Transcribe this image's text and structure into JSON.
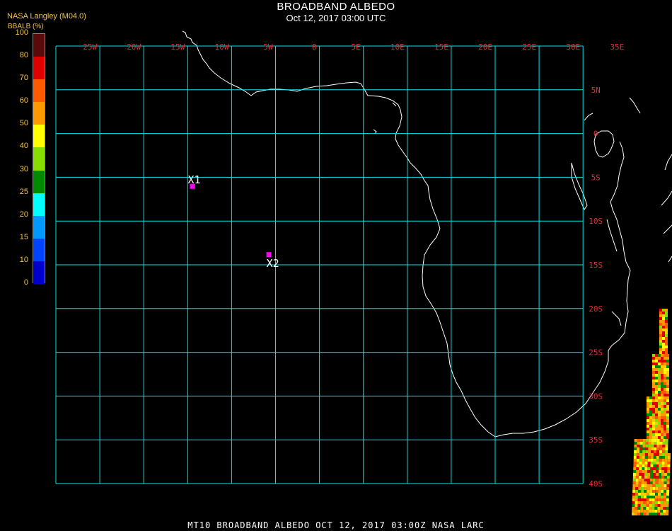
{
  "header": {
    "title": "BROADBAND ALBEDO",
    "subtitle": "Oct 12, 2017 03:00 UTC",
    "source": "NASA Langley (M04.0)"
  },
  "legend": {
    "title": "BBALB (%)",
    "bins": [
      {
        "label": "100",
        "color": "#5a0a0a"
      },
      {
        "label": "80",
        "color": "#e00000"
      },
      {
        "label": "70",
        "color": "#ff5a00"
      },
      {
        "label": "60",
        "color": "#ff9900"
      },
      {
        "label": "50",
        "color": "#ffff00"
      },
      {
        "label": "40",
        "color": "#88dd00"
      },
      {
        "label": "30",
        "color": "#008a00"
      },
      {
        "label": "25",
        "color": "#00ffff"
      },
      {
        "label": "20",
        "color": "#0099ff"
      },
      {
        "label": "15",
        "color": "#0044ff"
      },
      {
        "label": "10",
        "color": "#0000cc"
      },
      {
        "label": "0",
        "color": "#9933cc"
      }
    ]
  },
  "map": {
    "lon_labels": [
      "25W",
      "20W",
      "15W",
      "10W",
      "5W",
      "0",
      "5E",
      "10E",
      "15E",
      "20E",
      "25E",
      "30E",
      "35E"
    ],
    "lat_labels": [
      "5N",
      "0",
      "5S",
      "10S",
      "15S",
      "20S",
      "25S",
      "30S",
      "35S",
      "40S"
    ],
    "grid_color": "#00e5e5",
    "label_color": "#e03030",
    "markers": [
      {
        "label": "X1",
        "lon": -14.5,
        "lat": -6.0,
        "color": "#ff00ff"
      },
      {
        "label": "X2",
        "lon": -5.8,
        "lat": -13.8,
        "color": "#ff00ff"
      }
    ]
  },
  "footer": {
    "text": "MT10  BROADBAND ALBEDO   OCT 12, 2017 03:00Z   NASA LARC"
  }
}
